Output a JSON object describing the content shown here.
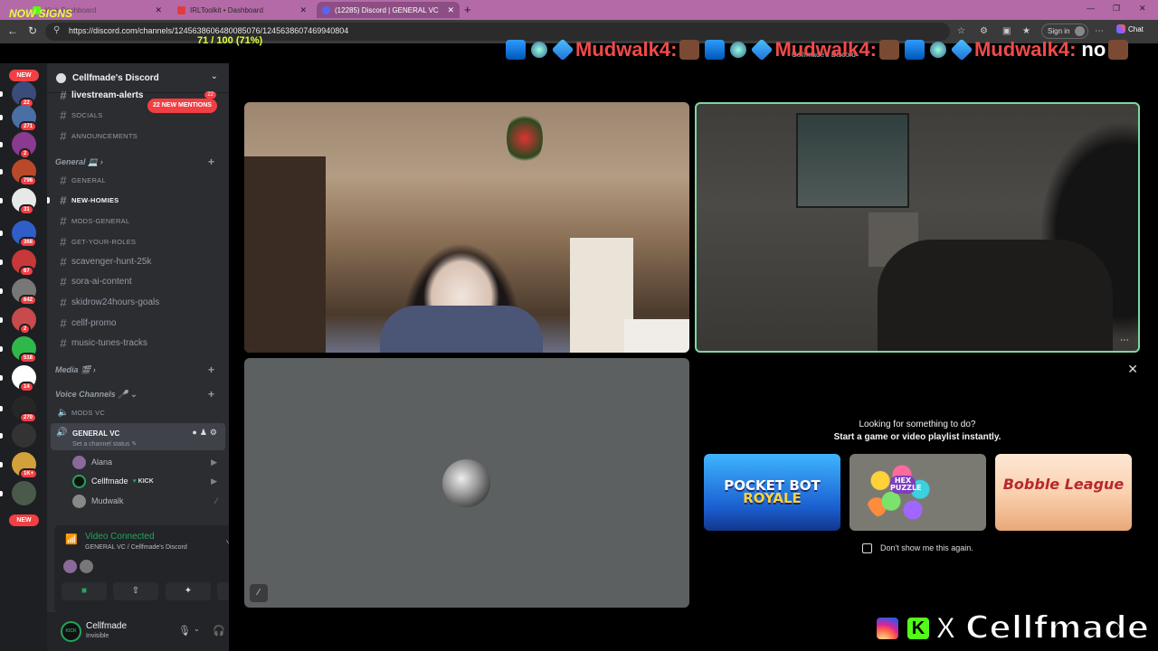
{
  "browser": {
    "tabs": [
      {
        "label": "Kick Dashboard"
      },
      {
        "label": "IRLToolkit • Dashboard"
      },
      {
        "label": "(12285) Discord | GENERAL VC"
      }
    ],
    "url": "https://discord.com/channels/1245638606480085076/1245638607469940804",
    "signin_label": "Sign in",
    "chat_label": "Chat"
  },
  "overlay": {
    "now_text": "NOW SIGNS",
    "counter_text": "71 / 100 (71%)",
    "ticker_name": "Mudwalk4:",
    "ticker_tail": "no"
  },
  "server": {
    "name": "Cellfmade's Discord",
    "mentions_pill": "22 NEW MENTIONS",
    "livestream_badge": "22"
  },
  "guilds": [
    {
      "badge": "NEW",
      "color": "#5865f2"
    },
    {
      "badge": "22",
      "color": "#3b4b7a"
    },
    {
      "badge": "271",
      "color": "#4a6fa5"
    },
    {
      "badge": "2",
      "color": "#8a3a8f"
    },
    {
      "badge": "796",
      "color": "#b84a2a"
    },
    {
      "badge": "31",
      "color": "#e8e8e8"
    },
    {
      "badge": "368",
      "color": "#2f5ec8"
    },
    {
      "badge": "67",
      "color": "#c73838"
    },
    {
      "badge": "642",
      "color": "#777777"
    },
    {
      "badge": "2",
      "color": "#c94a4a"
    },
    {
      "badge": "518",
      "color": "#2fb84a"
    },
    {
      "badge": "14",
      "color": "#ffffff"
    },
    {
      "badge": "270",
      "color": "#262626"
    },
    {
      "badge": "",
      "color": "#333333"
    },
    {
      "badge": "1K+",
      "color": "#d2a13a"
    },
    {
      "badge": "",
      "color": "#4a5a4a"
    },
    {
      "badge": "NEW",
      "color": "#5865f2"
    }
  ],
  "channels_top": [
    {
      "label": "livestream-alerts",
      "style": "normal"
    },
    {
      "label": "SOCIALS",
      "style": "small"
    },
    {
      "label": "ANNOUNCEMENTS",
      "style": "small"
    }
  ],
  "categories": {
    "general": "General 💻",
    "media": "Media 🎬",
    "voice": "Voice Channels 🎤"
  },
  "channels_general": [
    {
      "label": "GENERAL",
      "style": "small"
    },
    {
      "label": "NEW-HOMIES",
      "style": "small-bright"
    },
    {
      "label": "MODS-GENERAL",
      "style": "small"
    },
    {
      "label": "GET-YOUR-ROLES",
      "style": "small"
    },
    {
      "label": "scavenger-hunt-25k",
      "style": "normal"
    },
    {
      "label": "sora-ai-content",
      "style": "normal"
    },
    {
      "label": "skidrow24hours-goals",
      "style": "normal"
    },
    {
      "label": "cellf-promo",
      "style": "normal"
    },
    {
      "label": "music-tunes-tracks",
      "style": "normal"
    }
  ],
  "voice": {
    "mods_vc": "MODS VC",
    "general_vc": "GENERAL VC",
    "status_placeholder": "Set a channel status",
    "users": [
      {
        "name": "Alana",
        "tag": "",
        "color": "#8a6a9a"
      },
      {
        "name": "Cellfmade",
        "tag": "KICK",
        "color": "#111111"
      },
      {
        "name": "Mudwalk",
        "tag": "",
        "color": "#888888"
      }
    ]
  },
  "voice_panel": {
    "connected": "Video Connected",
    "location": "GENERAL VC / Cellfmade's Discord"
  },
  "user": {
    "name": "Cellfmade",
    "status": "Invisible",
    "avatar_text": "KICK"
  },
  "stage": {
    "title": "Cellfmade's Discord",
    "activity_q1": "Looking for something to do?",
    "activity_q2": "Start a game or video playlist instantly.",
    "games": [
      {
        "title": "POCKET BOT",
        "subtitle": "ROYALE"
      },
      {
        "title": "HEX PUZZLE",
        "subtitle": ""
      },
      {
        "title": "Bobble League",
        "subtitle": ""
      }
    ],
    "dont_show": "Don't show me this again."
  },
  "brand": {
    "name": "Cellfmade",
    "k": "K",
    "x": "X"
  }
}
